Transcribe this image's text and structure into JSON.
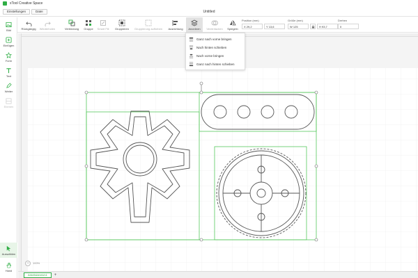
{
  "window": {
    "title": "xTool Creative Space"
  },
  "menu": {
    "items": [
      "Einstellungen",
      "Datei"
    ]
  },
  "document": {
    "title": "Untitled"
  },
  "toolbar": {
    "undo": "Rückgängig",
    "redo": "Wiederholen",
    "combine": "Verbindung",
    "group": "Gruppe",
    "smart_fill": "Smart Fill",
    "ungroup": "Gruppieren",
    "group_break": "Gruppierung aufheben",
    "align": "Ausrichtung",
    "arrange": "Anordnen",
    "merge": "Vereinfachen",
    "mirror": "Spiegeln",
    "position_label": "Position (mm)",
    "x_value": "X 29,2",
    "y_value": "Y 13,6",
    "size_label": "Größe (mm)",
    "w_value": "W 125",
    "h_value": "H 93,7",
    "rotate_label": "Drehen",
    "rotate_value": "0"
  },
  "sidebar": {
    "items": [
      {
        "label": "Bild",
        "icon": "image-icon"
      },
      {
        "label": "Einfügen",
        "icon": "insert-icon"
      },
      {
        "label": "Form",
        "icon": "shape-icon"
      },
      {
        "label": "Text",
        "icon": "text-icon"
      },
      {
        "label": "Weiter",
        "icon": "pen-icon"
      },
      {
        "label": "Ebenen",
        "icon": "layers-icon"
      }
    ],
    "bottom": [
      {
        "label": "Auswählen",
        "icon": "select-arrow-icon"
      },
      {
        "label": "Hand",
        "icon": "hand-icon"
      }
    ]
  },
  "arrange_menu": {
    "items": [
      "Ganz nach vorne bringen",
      "Nach hinten schieben",
      "Nach vorne bringen",
      "Ganz nach hinten schieben"
    ]
  },
  "zoom": {
    "minus": "−",
    "value": "100%"
  },
  "tabs": {
    "artboard": "Arbeitsbereich1",
    "add": "+"
  },
  "colors": {
    "accent": "#2fae45",
    "selection": "#56c95c"
  }
}
